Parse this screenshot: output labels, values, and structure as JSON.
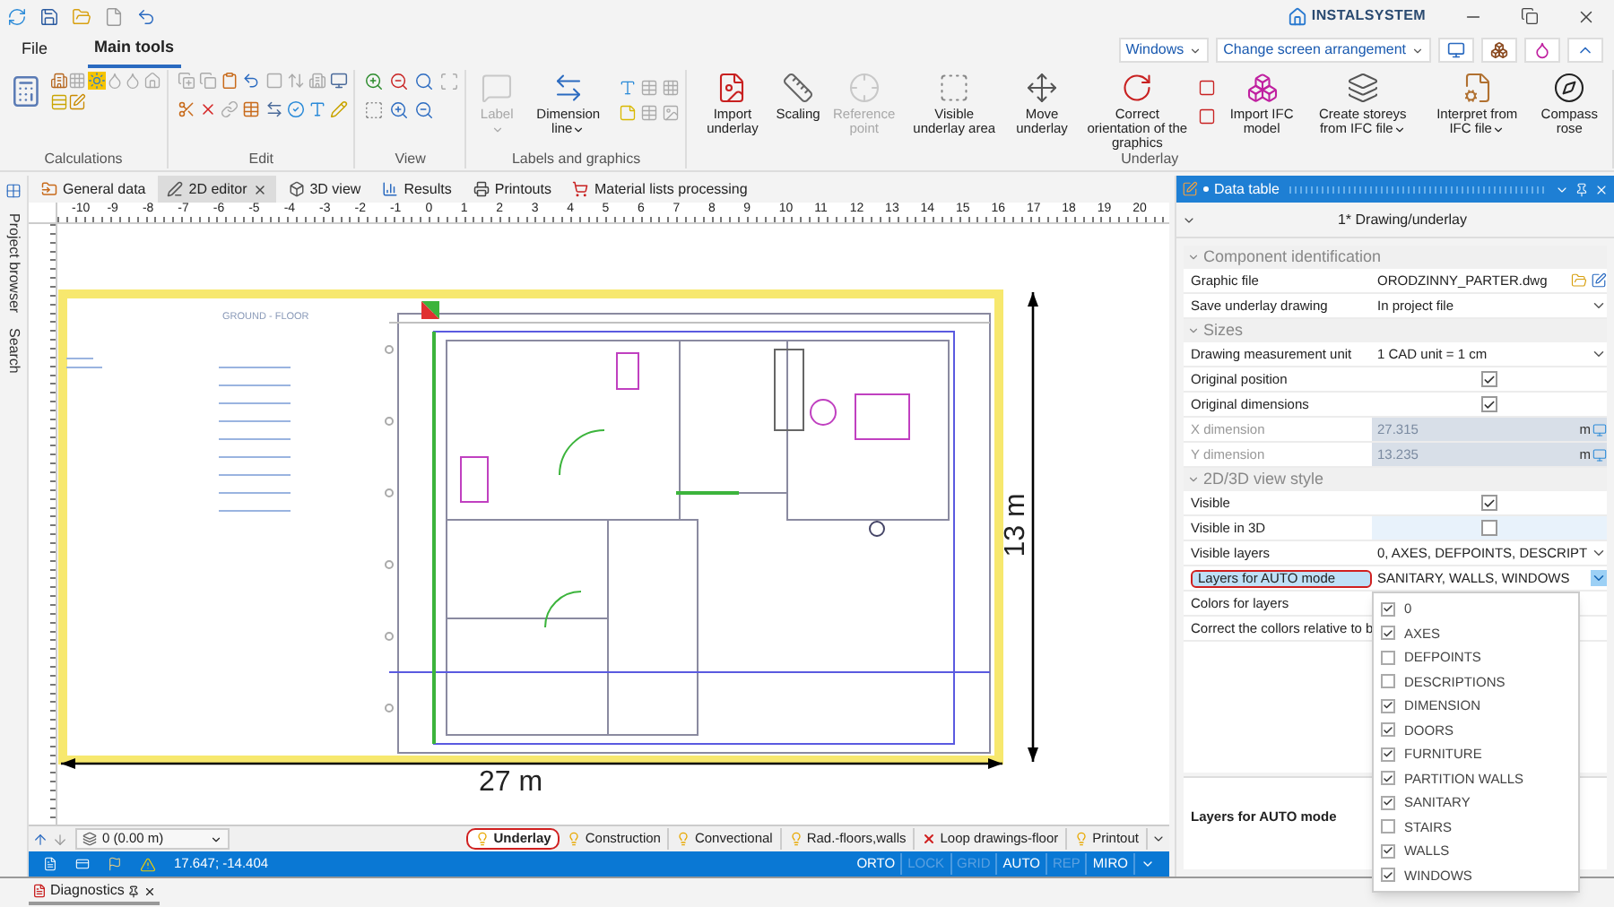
{
  "app": {
    "logo": "INSTALSYSTEM"
  },
  "menu_tabs": [
    {
      "label": "File",
      "selected": false
    },
    {
      "label": "Main tools",
      "selected": true
    }
  ],
  "toolbar_right": {
    "windows": "Windows",
    "arrangement": "Change screen arrangement"
  },
  "ribbon": {
    "groups": [
      {
        "label": "Calculations",
        "kind": "icons"
      },
      {
        "label": "Edit",
        "kind": "icons"
      },
      {
        "label": "View",
        "kind": "icons"
      },
      {
        "label": "Labels and graphics",
        "kind": "tools",
        "buttons": [
          {
            "label": "Label",
            "disabled": true,
            "menu": true
          },
          {
            "label": "Dimension line",
            "disabled": false,
            "menu": true
          }
        ]
      },
      {
        "label": "Underlay",
        "kind": "tools",
        "buttons": [
          {
            "label": "Import underlay",
            "disabled": false,
            "menu": false
          },
          {
            "label": "Scaling",
            "disabled": false,
            "menu": false
          },
          {
            "label": "Reference point",
            "disabled": true,
            "menu": false
          },
          {
            "label": "Visible underlay area",
            "disabled": false,
            "menu": false
          },
          {
            "label": "Move underlay",
            "disabled": false,
            "menu": false
          },
          {
            "label": "Correct orientation of the graphics",
            "disabled": false,
            "menu": false
          },
          {
            "label": "Import IFC model",
            "disabled": false,
            "menu": false
          },
          {
            "label": "Create storeys from IFC file",
            "disabled": false,
            "menu": true
          },
          {
            "label": "Interpret from IFC file",
            "disabled": false,
            "menu": true
          },
          {
            "label": "Compass rose",
            "disabled": false,
            "menu": false
          }
        ]
      }
    ]
  },
  "side_strip": [
    "Project browser",
    "Search"
  ],
  "editor_tabs": [
    {
      "label": "General data",
      "selected": false
    },
    {
      "label": "2D editor",
      "selected": true
    },
    {
      "label": "3D view",
      "selected": false
    },
    {
      "label": "Results",
      "selected": false
    },
    {
      "label": "Printouts",
      "selected": false
    },
    {
      "label": "Material lists processing",
      "selected": false
    }
  ],
  "ruler": [
    "-10",
    "-9",
    "-8",
    "-7",
    "-6",
    "-5",
    "-4",
    "-3",
    "-2",
    "-1",
    "0",
    "1",
    "2",
    "3",
    "4",
    "5",
    "6",
    "7",
    "8",
    "9",
    "10",
    "11",
    "12",
    "13",
    "14",
    "15",
    "16",
    "17",
    "18",
    "19",
    "20"
  ],
  "drawing": {
    "title": "GROUND - FLOOR",
    "height": "13 m",
    "width": "27 m"
  },
  "storey": "0 (0.00 m)",
  "layers": [
    {
      "label": "Underlay",
      "selected": true,
      "kind": "bulb"
    },
    {
      "label": "Construction",
      "selected": false,
      "kind": "bulb"
    },
    {
      "label": "Convectional",
      "selected": false,
      "kind": "bulb"
    },
    {
      "label": "Rad.-floors,walls",
      "selected": false,
      "kind": "bulb"
    },
    {
      "label": "Loop drawings-floor",
      "selected": false,
      "kind": "off"
    },
    {
      "label": "Printout",
      "selected": false,
      "kind": "bulb"
    }
  ],
  "status": {
    "coords": "17.647; -14.404",
    "flags": [
      {
        "label": "ORTO",
        "disabled": false
      },
      {
        "label": "LOCK",
        "disabled": true
      },
      {
        "label": "GRID",
        "disabled": true
      },
      {
        "label": "AUTO",
        "disabled": false
      },
      {
        "label": "REP",
        "disabled": true
      },
      {
        "label": "MIRO",
        "disabled": false
      }
    ]
  },
  "bottom_tab": "Diagnostics",
  "data_table": {
    "title": "Data table",
    "object": "1* Drawing/underlay",
    "categories": [
      {
        "title": "Component identification",
        "expanded": true,
        "rows": [
          {
            "label": "Graphic file",
            "kind": "file",
            "value": "ORODZINNY_PARTER.dwg",
            "disabled": false,
            "selected": false
          },
          {
            "label": "Save underlay drawing",
            "kind": "dropdown",
            "value": "In project file",
            "disabled": false,
            "selected": false
          }
        ]
      },
      {
        "title": "Sizes",
        "expanded": true,
        "rows": [
          {
            "label": "Drawing measurement unit",
            "kind": "dropdown",
            "value": "1 CAD unit = 1 cm",
            "disabled": false,
            "selected": false
          },
          {
            "label": "Original position",
            "kind": "checkbox",
            "checked": true,
            "disabled": false,
            "selected": false
          },
          {
            "label": "Original dimensions",
            "kind": "checkbox",
            "checked": true,
            "disabled": false,
            "selected": false
          },
          {
            "label": "X dimension",
            "kind": "number",
            "value": "27.315",
            "unit": "m",
            "disabled": true,
            "selected": false
          },
          {
            "label": "Y dimension",
            "kind": "number",
            "value": "13.235",
            "unit": "m",
            "disabled": true,
            "selected": false
          }
        ]
      },
      {
        "title": "2D/3D view style",
        "expanded": true,
        "rows": [
          {
            "label": "Visible",
            "kind": "checkbox",
            "checked": true,
            "disabled": false,
            "selected": false
          },
          {
            "label": "Visible in 3D",
            "kind": "checkbox",
            "checked": false,
            "disabled": false,
            "selected": false
          },
          {
            "label": "Visible layers",
            "kind": "dropdown",
            "value": "0, AXES, DEFPOINTS, DESCRIPT",
            "disabled": false,
            "selected": false
          },
          {
            "label": "Layers for AUTO mode",
            "kind": "dropdown",
            "value": "SANITARY, WALLS, WINDOWS",
            "disabled": false,
            "selected": true
          },
          {
            "label": "Colors for layers",
            "kind": "empty",
            "disabled": false,
            "selected": false
          },
          {
            "label": "Correct the collors relative to b",
            "kind": "empty",
            "disabled": false,
            "selected": false
          }
        ]
      }
    ],
    "popup": [
      {
        "label": "0",
        "checked": true
      },
      {
        "label": "AXES",
        "checked": true
      },
      {
        "label": "DEFPOINTS",
        "checked": false
      },
      {
        "label": "DESCRIPTIONS",
        "checked": false
      },
      {
        "label": "DIMENSION",
        "checked": true
      },
      {
        "label": "DOORS",
        "checked": true
      },
      {
        "label": "FURNITURE",
        "checked": true
      },
      {
        "label": "PARTITION WALLS",
        "checked": true
      },
      {
        "label": "SANITARY",
        "checked": true
      },
      {
        "label": "STAIRS",
        "checked": false
      },
      {
        "label": "WALLS",
        "checked": true
      },
      {
        "label": "WINDOWS",
        "checked": true
      }
    ],
    "description": "Layers for AUTO mode"
  }
}
